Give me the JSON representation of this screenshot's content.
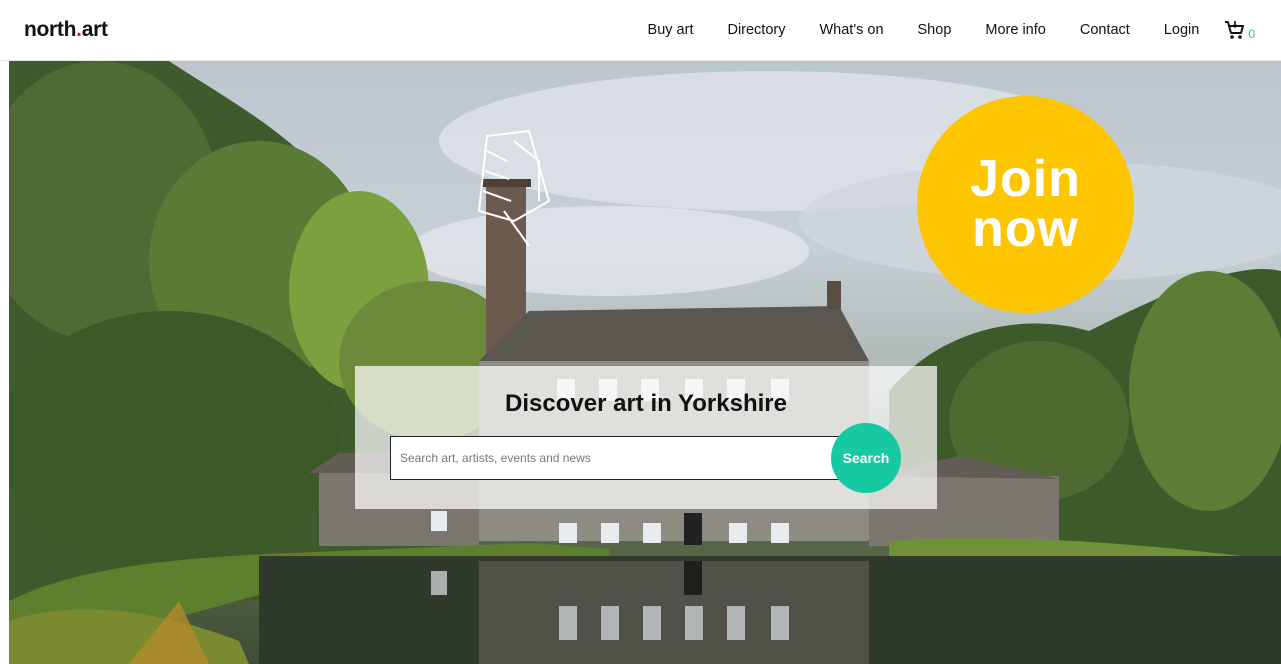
{
  "header": {
    "logo_main": "north",
    "logo_dot": ".",
    "logo_tail": "art",
    "nav": [
      "Buy art",
      "Directory",
      "What's on",
      "Shop",
      "More info",
      "Contact",
      "Login"
    ],
    "cart_icon": "cart-icon",
    "cart_count": "0"
  },
  "hero": {
    "join_line1": "Join",
    "join_line2": "now",
    "title": "Discover art in Yorkshire",
    "search_placeholder": "Search art, artists, events and news",
    "search_button": "Search"
  },
  "colors": {
    "accent": "#17c9a3",
    "join": "#fdc600",
    "logo_dot": "#e6007e"
  }
}
